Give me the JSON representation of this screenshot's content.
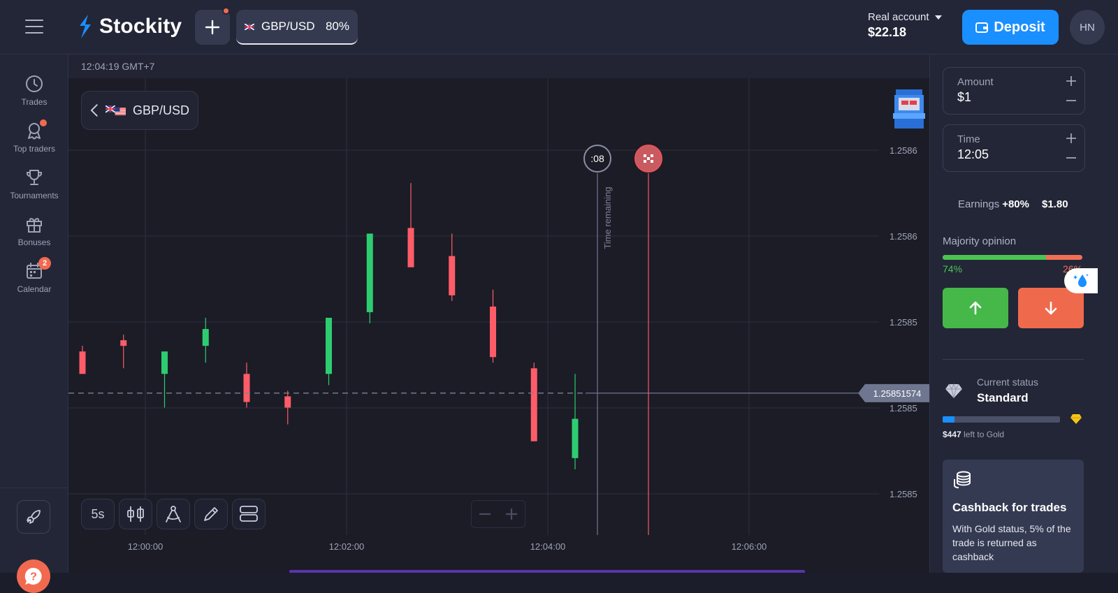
{
  "header": {
    "brand": "Stockity",
    "asset_tab": {
      "name": "GBP/USD",
      "payout": "80%"
    },
    "account": {
      "label": "Real account",
      "balance": "$22.18"
    },
    "deposit_label": "Deposit",
    "avatar_initials": "HN"
  },
  "sidebar": {
    "items": [
      {
        "label": "Trades",
        "icon": "clock-icon"
      },
      {
        "label": "Top traders",
        "icon": "award-icon"
      },
      {
        "label": "Tournaments",
        "icon": "trophy-icon"
      },
      {
        "label": "Bonuses",
        "icon": "gift-icon"
      },
      {
        "label": "Calendar",
        "icon": "calendar-icon",
        "badge": "2"
      }
    ]
  },
  "chart": {
    "time_label": "12:04:19 GMT+7",
    "pair": "GBP/USD",
    "countdown": ":08",
    "time_remaining_label": "Time remaining",
    "current_price": "1.25851574",
    "price_ticks": [
      "1.2586",
      "1.2586",
      "1.2585",
      "1.2585",
      "1.2585"
    ],
    "time_ticks": [
      "12:00:00",
      "12:02:00",
      "12:04:00",
      "12:06:00"
    ],
    "interval": "5s",
    "colors": {
      "up": "#2ecc71",
      "down": "#ff5c68",
      "expiry": "#e8545c"
    }
  },
  "chart_data": {
    "type": "candlestick",
    "x": [
      "12:00:00",
      "12:02:00",
      "12:04:00",
      "12:06:00"
    ],
    "candles": [
      {
        "o": 1.25859,
        "h": 1.2586,
        "l": 1.25856,
        "c": 1.25855
      },
      {
        "o": 1.25861,
        "h": 1.25862,
        "l": 1.25856,
        "c": 1.2586
      },
      {
        "o": 1.25855,
        "h": 1.25856,
        "l": 1.25849,
        "c": 1.25859
      },
      {
        "o": 1.2586,
        "h": 1.25865,
        "l": 1.25857,
        "c": 1.25863
      },
      {
        "o": 1.25855,
        "h": 1.25857,
        "l": 1.25849,
        "c": 1.2585
      },
      {
        "o": 1.25851,
        "h": 1.25852,
        "l": 1.25846,
        "c": 1.25849
      },
      {
        "o": 1.25855,
        "h": 1.25864,
        "l": 1.25853,
        "c": 1.25865
      },
      {
        "o": 1.25866,
        "h": 1.25876,
        "l": 1.25864,
        "c": 1.2588
      },
      {
        "o": 1.25881,
        "h": 1.25889,
        "l": 1.25876,
        "c": 1.25874
      },
      {
        "o": 1.25876,
        "h": 1.2588,
        "l": 1.25868,
        "c": 1.25869
      },
      {
        "o": 1.25867,
        "h": 1.2587,
        "l": 1.25857,
        "c": 1.25858
      },
      {
        "o": 1.25856,
        "h": 1.25857,
        "l": 1.25843,
        "c": 1.25843
      },
      {
        "o": 1.2584,
        "h": 1.25855,
        "l": 1.25838,
        "c": 1.25847
      }
    ],
    "current_price": 1.25851574
  },
  "panel": {
    "amount": {
      "label": "Amount",
      "value": "$1"
    },
    "time": {
      "label": "Time",
      "value": "12:05"
    },
    "earnings": {
      "label": "Earnings",
      "pct": "+80%",
      "amount": "$1.80"
    },
    "majority": {
      "label": "Majority opinion",
      "up_pct": "74%",
      "down_pct": "26%",
      "up_fraction": 0.74
    },
    "status": {
      "label": "Current status",
      "value": "Standard",
      "progress_fraction": 0.1,
      "left_amount": "$447",
      "left_text": "left to Gold"
    },
    "cashback": {
      "title": "Cashback for trades",
      "text": "With Gold status, 5% of the trade is returned as cashback"
    }
  }
}
